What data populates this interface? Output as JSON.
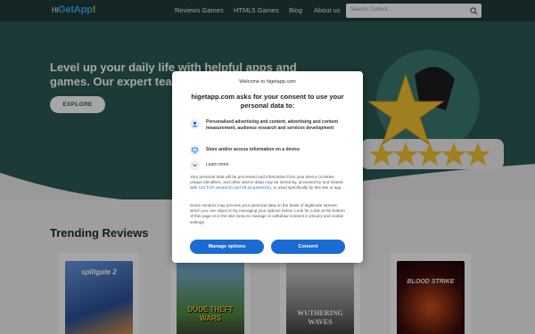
{
  "header": {
    "logo": {
      "hi": "Hi",
      "get": "GetApp",
      "excl": "!"
    },
    "nav": [
      "Reviews Games",
      "HTML5 Games",
      "Blog",
      "About us"
    ],
    "search_placeholder": "Search Content...",
    "search_icon": "search-icon"
  },
  "hero": {
    "headline": "Level up your daily life with helpful apps and games. Our expert tea",
    "button": "EXPLORE"
  },
  "trending": {
    "title": "Trending Reviews",
    "cards": [
      {
        "title": "splitgate 2",
        "color": "#5a8ad8"
      },
      {
        "title": "DUDE THEFT WARS",
        "color": "#6aa0d8"
      },
      {
        "title": "WUTHERING WAVES",
        "color": "#7c7c7c"
      },
      {
        "title": "BLOOD STRIKE",
        "color": "#2a1010"
      }
    ]
  },
  "consent": {
    "welcome": "Welcome to higetapp.com",
    "heading": "higetapp.com asks for your consent to use your personal data to:",
    "purposes": [
      {
        "icon": "person-icon",
        "text": "Personalised advertising and content, advertising and content measurement, audience research and services development"
      },
      {
        "icon": "device-icon",
        "text": "Store and/or access information on a device"
      },
      {
        "icon": "chevron-down-icon",
        "text": "Learn more"
      }
    ],
    "body1_start": "Your personal data will be processed and information from your device (cookies, unique identifiers, and other device data) may be stored by, accessed by and shared with ",
    "body1_link": "142 TCF vendor(s) and 69 ad partner(s)",
    "body1_end": ", or used specifically by this site or app.",
    "body2": "Some vendors may process your personal data on the basis of legitimate interest, which you can object to by managing your options below. Look for a link at the bottom of this page or in the site menu to manage or withdraw consent in privacy and cookie settings.",
    "manage_label": "Manage options",
    "consent_label": "Consent"
  },
  "colors": {
    "header": "#1f3b3b",
    "hero": "#2b5a55",
    "accent": "#1a6bd4",
    "star": "#f4c430"
  }
}
